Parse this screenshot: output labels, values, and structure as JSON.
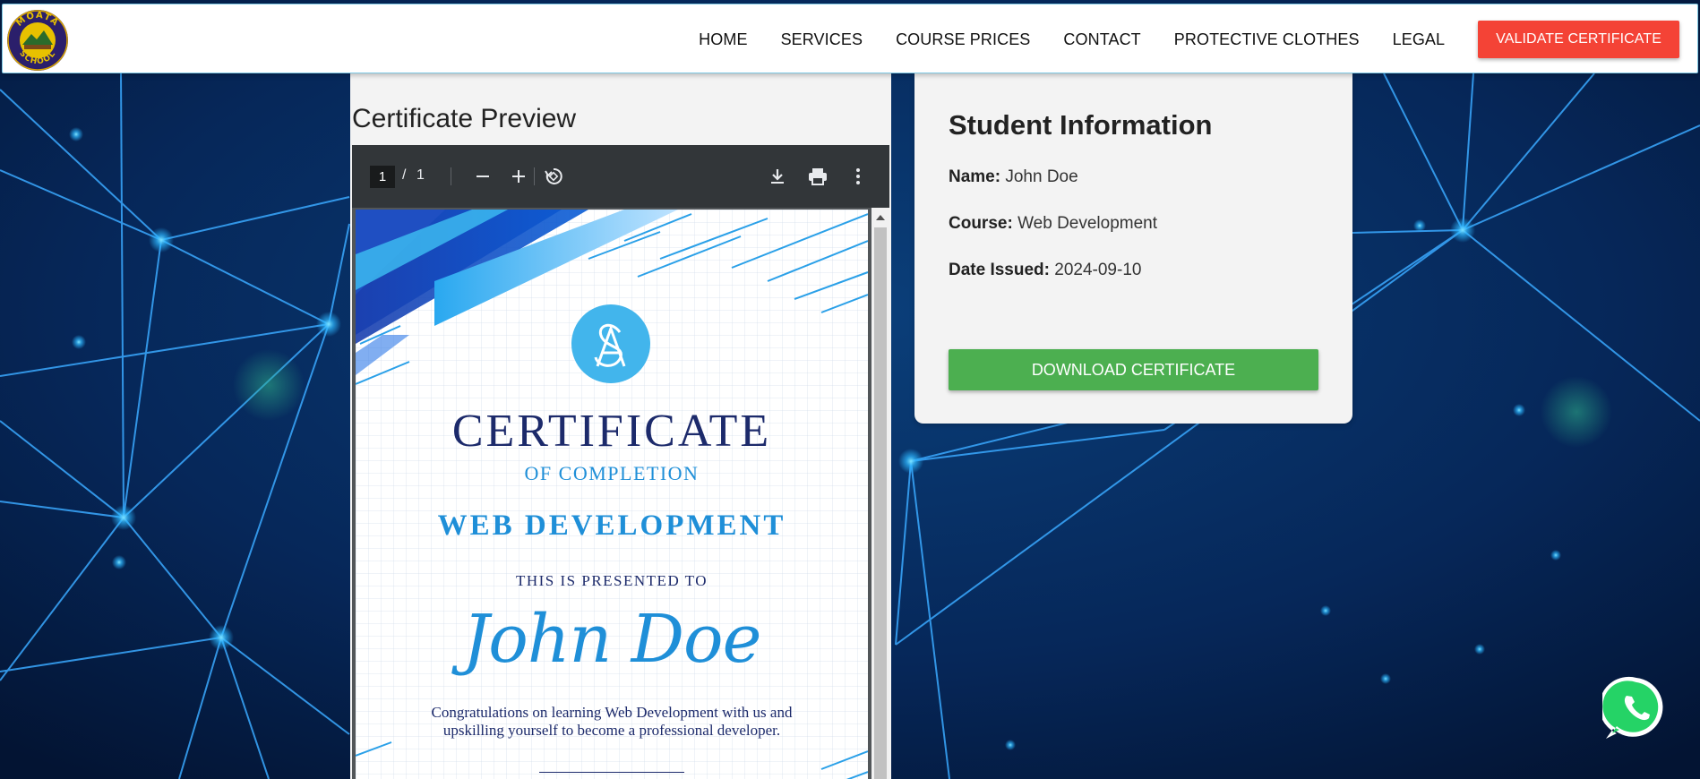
{
  "brand": {
    "logo_top_text": "MOATA",
    "logo_bottom_text": "SCHOOL"
  },
  "nav": {
    "items": [
      "HOME",
      "SERVICES",
      "COURSE PRICES",
      "CONTACT",
      "PROTECTIVE CLOTHES",
      "LEGAL"
    ],
    "cta_label": "VALIDATE CERTIFICATE"
  },
  "preview": {
    "title": "Certificate Preview",
    "toolbar": {
      "page_current": "1",
      "page_sep": "/",
      "page_total": "1"
    },
    "certificate": {
      "title": "CERTIFICATE",
      "subtitle": "OF COMPLETION",
      "course": "WEB DEVELOPMENT",
      "presented": "THIS IS PRESENTED TO",
      "name": "John Doe",
      "message": "Congratulations on learning Web Development with us and upskilling yourself to become a professional developer."
    }
  },
  "student": {
    "title": "Student Information",
    "name_label": "Name:",
    "name_value": "John Doe",
    "course_label": "Course:",
    "course_value": "Web Development",
    "date_label": "Date Issued:",
    "date_value": "2024-09-10",
    "download_label": "DOWNLOAD CERTIFICATE"
  },
  "colors": {
    "cta": "#f44336",
    "download": "#4caf50",
    "cert_navy": "#1c2a6b",
    "cert_blue": "#1f8fd8",
    "whatsapp": "#25d366"
  }
}
